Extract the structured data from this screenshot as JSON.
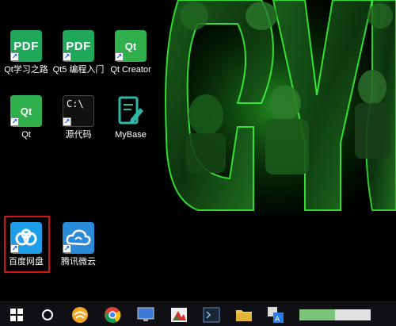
{
  "desktop": {
    "icons": [
      {
        "label": "Qt学习之路",
        "tile_text": "PDF"
      },
      {
        "label": "Qt5 编程入门",
        "tile_text": "PDF"
      },
      {
        "label": "Qt Creator",
        "tile_text": "Qt"
      },
      {
        "label": "Qt",
        "tile_text": "Qt"
      },
      {
        "label": "源代码",
        "tile_text": "C:\\"
      },
      {
        "label": "MyBase",
        "tile_text": ""
      },
      {
        "label": "百度网盘",
        "tile_text": ""
      },
      {
        "label": "腾讯微云",
        "tile_text": ""
      }
    ],
    "selected_icon": "百度网盘"
  },
  "taskbar": {
    "items": [
      "start-button",
      "search-circle",
      "browser",
      "chrome",
      "desktop-app",
      "media-app",
      "terminal-app",
      "file-explorer",
      "translator",
      "progress-app"
    ]
  },
  "colors": {
    "pdf_green": "#1fa85a",
    "qt_green": "#2fb04c",
    "baidu_blue": "#1e9ee8",
    "selection_red": "#d31414",
    "taskbar": "#101014"
  }
}
